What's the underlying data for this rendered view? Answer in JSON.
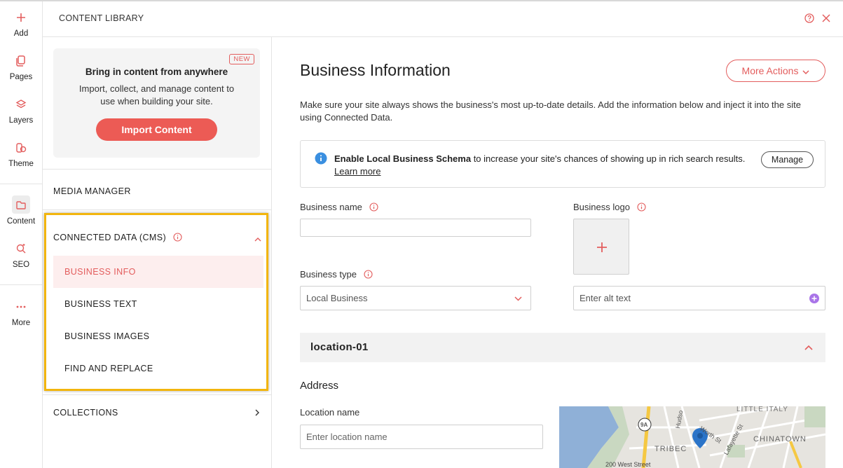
{
  "rail": {
    "items": [
      {
        "label": "Add",
        "icon": "plus-icon"
      },
      {
        "label": "Pages",
        "icon": "pages-icon"
      },
      {
        "label": "Layers",
        "icon": "layers-icon"
      },
      {
        "label": "Theme",
        "icon": "theme-icon"
      },
      {
        "label": "Content",
        "icon": "folder-icon",
        "active": true
      },
      {
        "label": "SEO",
        "icon": "seo-icon"
      },
      {
        "label": "More",
        "icon": "more-dots-icon"
      }
    ]
  },
  "header": {
    "title": "CONTENT LIBRARY"
  },
  "promo": {
    "badge": "NEW",
    "title": "Bring in content from anywhere",
    "description": "Import, collect, and manage content to use when building your site.",
    "button": "Import Content"
  },
  "panel": {
    "media_manager": "MEDIA MANAGER",
    "connected_data": "CONNECTED DATA (CMS)",
    "cms_items": [
      "BUSINESS INFO",
      "BUSINESS TEXT",
      "BUSINESS IMAGES",
      "FIND AND REPLACE"
    ],
    "collections": "COLLECTIONS"
  },
  "main": {
    "title": "Business Information",
    "more_actions": "More Actions",
    "intro": "Make sure your site always shows the business's most up-to-date details. Add the information below and inject it into the site using Connected Data.",
    "notice": {
      "bold": "Enable Local Business Schema",
      "rest": " to increase your site's chances of showing up in rich search results.",
      "link": "Learn more",
      "button": "Manage"
    },
    "business_name_label": "Business name",
    "business_name_value": "",
    "business_logo_label": "Business logo",
    "business_type_label": "Business type",
    "business_type_value": "Local Business",
    "alt_text_placeholder": "Enter alt text",
    "location_title": "location-01",
    "address_heading": "Address",
    "location_name_label": "Location name",
    "location_name_placeholder": "Enter location name",
    "map_labels": {
      "little_italy": "LITTLE ITALY",
      "chinatown": "CHINATOWN",
      "tribeca": "TRIBEC",
      "street": "200 West Street",
      "hudson": "Hudso",
      "worth": "Worth St",
      "lafayette": "Lafayette St",
      "route": "9A"
    }
  },
  "colors": {
    "accent": "#ec5b55",
    "accent_text": "#e35d5d",
    "highlight": "#f2b50e",
    "info_blue": "#3a8fe0",
    "purple": "#a974e8"
  }
}
